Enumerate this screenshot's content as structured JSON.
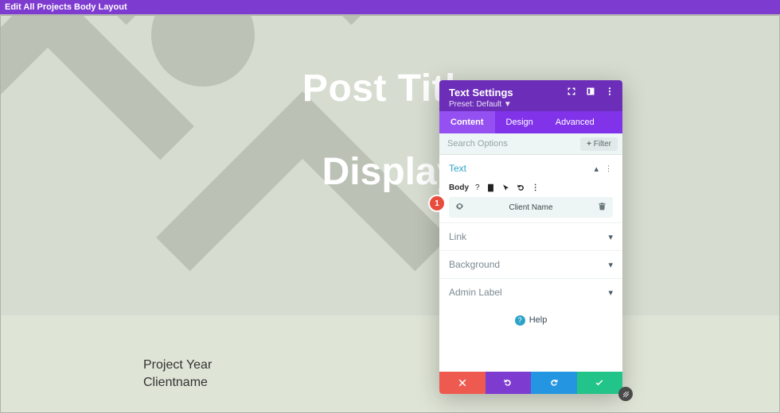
{
  "topbar": {
    "title": "Edit All Projects Body Layout"
  },
  "hero": {
    "title": "Post Title",
    "subtitle": "Display"
  },
  "meta": {
    "line1": "Project Year",
    "line2": "Clientname"
  },
  "badge": {
    "number": "1"
  },
  "panel": {
    "title": "Text Settings",
    "preset": "Preset: Default ▼",
    "tabs": {
      "content": "Content",
      "design": "Design",
      "advanced": "Advanced"
    },
    "search_placeholder": "Search Options",
    "filter_label": "Filter",
    "sections": {
      "text_label": "Text",
      "link_label": "Link",
      "background_label": "Background",
      "admin_label": "Admin Label"
    },
    "body": {
      "label": "Body",
      "field_name": "Client Name"
    },
    "help_label": "Help"
  }
}
